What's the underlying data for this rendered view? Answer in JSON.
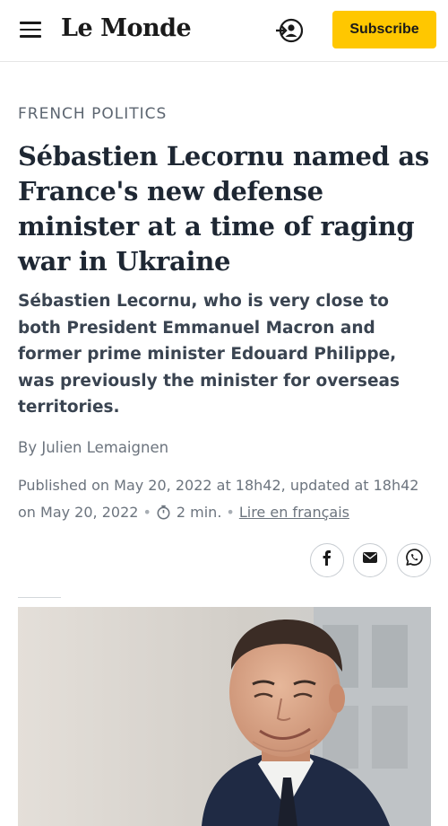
{
  "header": {
    "logo": "Le Monde",
    "subscribe_label": "Subscribe"
  },
  "article": {
    "kicker": "FRENCH POLITICS",
    "headline": "Sébastien Lecornu named as France's new defense minister at a time of raging war in Ukraine",
    "standfirst": "Sébastien Lecornu, who is very close to both President Emmanuel Macron and former prime minister Edouard Philippe, was previously the minister for overseas territories.",
    "byline_prefix": "By",
    "author": "Julien Lemaignen",
    "published": "Published on May 20, 2022 at 18h42, updated at 18h42 on May 20, 2022",
    "reading_time": "2 min.",
    "french_link": "Lire en français"
  },
  "share": {
    "icons": [
      "facebook-icon",
      "email-icon",
      "whatsapp-icon"
    ]
  },
  "colors": {
    "accent": "#ffc700",
    "text": "#1e2733",
    "muted": "#6c747e"
  }
}
